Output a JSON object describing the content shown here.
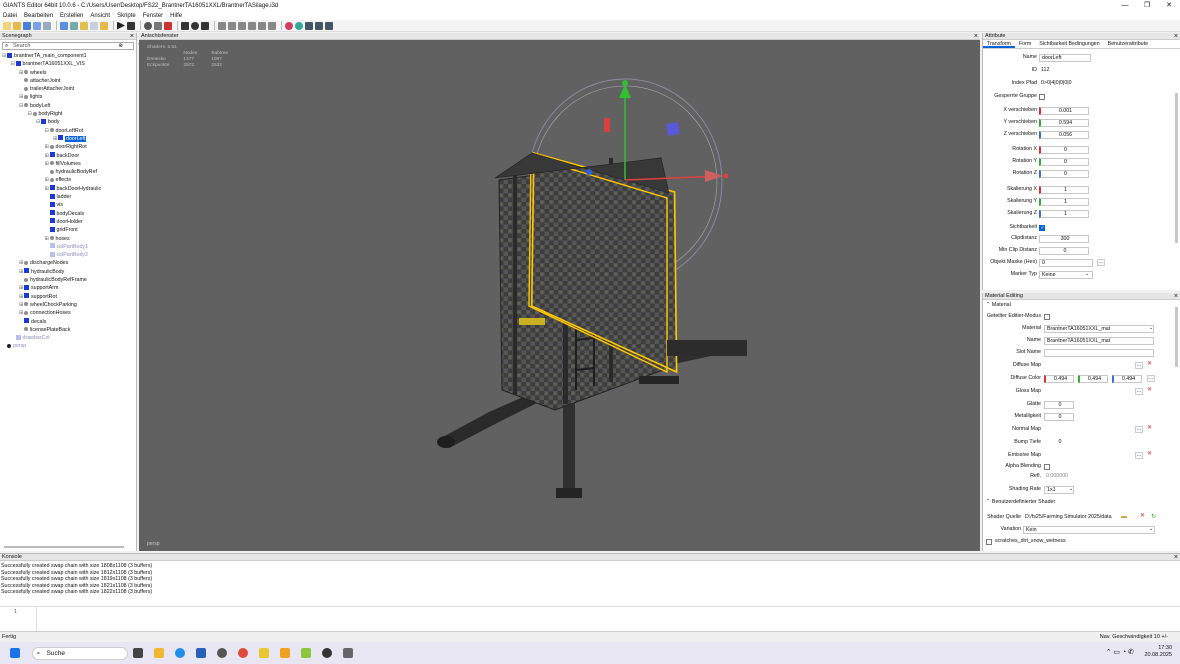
{
  "window": {
    "title": "GIANTS Editor 64bit 10.0.6 - C:/Users/User/Desktop/FS22_BrantnerTA16051XXL/BrantnerTASilage.i3d",
    "controls": [
      "—",
      "❐",
      "✕"
    ]
  },
  "menu": [
    "Datei",
    "Bearbeiten",
    "Erstellen",
    "Ansicht",
    "Skripte",
    "Fenster",
    "Hilfe"
  ],
  "scenegraph": {
    "title": "Scenegraph",
    "search_placeholder": "Search",
    "items": [
      {
        "label": "brantnerTA_main_component1",
        "depth": 0,
        "icon": "blue",
        "exp": "⊟"
      },
      {
        "label": "brantnerTA16051XXL_VIS",
        "depth": 1,
        "icon": "blue",
        "exp": "⊟"
      },
      {
        "label": "wheels",
        "depth": 2,
        "icon": "tg",
        "exp": "⊞"
      },
      {
        "label": "attacherJoint",
        "depth": 2,
        "icon": "tg",
        "exp": ""
      },
      {
        "label": "trailerAttacherJoint",
        "depth": 2,
        "icon": "tg",
        "exp": ""
      },
      {
        "label": "lights",
        "depth": 2,
        "icon": "tg",
        "exp": "⊞"
      },
      {
        "label": "bodyLeft",
        "depth": 2,
        "icon": "tg",
        "exp": "⊟"
      },
      {
        "label": "bodyRight",
        "depth": 3,
        "icon": "tg",
        "exp": "⊟"
      },
      {
        "label": "body",
        "depth": 4,
        "icon": "blue",
        "exp": "⊟"
      },
      {
        "label": "doorLeftRot",
        "depth": 5,
        "icon": "tg",
        "exp": "⊟"
      },
      {
        "label": "doorLeft",
        "depth": 6,
        "icon": "blue",
        "exp": "⊞",
        "selected": true
      },
      {
        "label": "doorRightRot",
        "depth": 5,
        "icon": "tg",
        "exp": "⊞"
      },
      {
        "label": "backDoor",
        "depth": 5,
        "icon": "blue",
        "exp": "⊞"
      },
      {
        "label": "fillVolumes",
        "depth": 5,
        "icon": "tg",
        "exp": "⊞"
      },
      {
        "label": "hydraulicBodyRef",
        "depth": 5,
        "icon": "tg",
        "exp": ""
      },
      {
        "label": "effects",
        "depth": 5,
        "icon": "tg",
        "exp": "⊞"
      },
      {
        "label": "backDoorHydraulic",
        "depth": 5,
        "icon": "blue",
        "exp": "⊞"
      },
      {
        "label": "ladder",
        "depth": 5,
        "icon": "blue",
        "exp": ""
      },
      {
        "label": "vis",
        "depth": 5,
        "icon": "blue",
        "exp": ""
      },
      {
        "label": "bodyDecals",
        "depth": 5,
        "icon": "blue",
        "exp": ""
      },
      {
        "label": "doorHolder",
        "depth": 5,
        "icon": "blue",
        "exp": ""
      },
      {
        "label": "gridFront",
        "depth": 5,
        "icon": "blue",
        "exp": ""
      },
      {
        "label": "hoses",
        "depth": 5,
        "icon": "tg",
        "exp": "⊞"
      },
      {
        "label": "colPartBody1",
        "depth": 5,
        "icon": "light",
        "exp": "",
        "dim": true
      },
      {
        "label": "colPartBody2",
        "depth": 5,
        "icon": "light",
        "exp": "",
        "dim": true
      },
      {
        "label": "dischargeNodes",
        "depth": 2,
        "icon": "tg",
        "exp": "⊞"
      },
      {
        "label": "hydraulicBody",
        "depth": 2,
        "icon": "blue",
        "exp": "⊞"
      },
      {
        "label": "hydraulicBodyRefFrame",
        "depth": 2,
        "icon": "tg",
        "exp": ""
      },
      {
        "label": "supportArm",
        "depth": 2,
        "icon": "blue",
        "exp": "⊞"
      },
      {
        "label": "supportRot",
        "depth": 2,
        "icon": "blue",
        "exp": "⊞"
      },
      {
        "label": "wheelChockParking",
        "depth": 2,
        "icon": "tg",
        "exp": "⊞"
      },
      {
        "label": "connectionHoses",
        "depth": 2,
        "icon": "tg",
        "exp": "⊞"
      },
      {
        "label": "decals",
        "depth": 2,
        "icon": "blue",
        "exp": ""
      },
      {
        "label": "licensePlateBack",
        "depth": 2,
        "icon": "tg",
        "exp": ""
      },
      {
        "label": "drawbarCol",
        "depth": 1,
        "icon": "light",
        "exp": "",
        "dim": true
      },
      {
        "label": "persp",
        "depth": 0,
        "icon": "cam",
        "exp": "",
        "dim": true
      }
    ]
  },
  "viewport": {
    "title": "Anischtsfenster",
    "stats": {
      "header": "Shaders: 6.51",
      "col1": "Nodes",
      "col2": "Subtree",
      "rows": [
        {
          "label": "Dreiecke",
          "a": "1477",
          "b": "1997"
        },
        {
          "label": "Eckpunkte",
          "a": "2572",
          "b": "2632"
        }
      ]
    },
    "camera": "persp"
  },
  "attribute": {
    "title": "Attribute",
    "tabs": [
      "Transform",
      "Form",
      "Sichtbarkeit Bedingungen",
      "Benutzerattribute"
    ],
    "fields": {
      "name_label": "Name",
      "name": "doorLeft",
      "id_label": "ID",
      "id": "112",
      "index_label": "Index Pfad",
      "index": "0>0|4|0|0|0|0",
      "locked_label": "Gesperrte Gruppe",
      "x_label": "X verschieben",
      "x": "0.001",
      "y_label": "Y verschieben",
      "y": "0.594",
      "z_label": "Z verschieben",
      "z": "0.056",
      "rx_label": "Rotation X",
      "rx": "0",
      "ry_label": "Rotation Y",
      "ry": "0",
      "rz_label": "Rotation Z",
      "rz": "0",
      "sx_label": "Skalierung X",
      "sx": "1",
      "sy_label": "Skalierung Y",
      "sy": "1",
      "sz_label": "Skalierung Z",
      "sz": "1",
      "vis_label": "Sichtbarkeit",
      "clip_label": "Clipdistanz",
      "clip": "300",
      "minclip_label": "Min Clip Distanz",
      "minclip": "0",
      "mask_label": "Objekt Maske (Hex)",
      "mask": "0",
      "marker_label": "Marker Typ",
      "marker": "Keine"
    }
  },
  "material": {
    "title": "Material Editing",
    "section1": "Material",
    "shared_label": "Geteilter Editier-Modus",
    "material_label": "Material",
    "material": "BrantnerTA16051XXL_mat",
    "name_label": "Name",
    "name": "BrantnerTA16051XXL_mat",
    "slot_label": "Slot Name",
    "slot": "",
    "diffuse_map_label": "Diffuse Map",
    "diffuse_color_label": "Diffuse Color",
    "dr": "0.494",
    "dg": "0.494",
    "db": "0.494",
    "gloss_label": "Gloss Map",
    "glatte_label": "Glätte",
    "glatte": "0",
    "metal_label": "Metalligkeit",
    "metal": "0",
    "normal_label": "Normal Map",
    "bump_label": "Bump Tiefe",
    "bump": "0",
    "emissive_label": "Emissive Map",
    "alpha_label": "Alpha Blending",
    "refl_label": "Refl.",
    "refl": "0.000000",
    "shading_label": "Shading Rate",
    "shading": "1x1",
    "section2": "Benutzerdefinierter Shader",
    "shader_label": "Shader Quelle",
    "shader": "D:/fs25/Farming Simulator 2025/data",
    "variation_label": "Variation",
    "variation": "Kein",
    "extra": "scratches_dirt_snow_wetness"
  },
  "console": {
    "title": "Konsole",
    "lines": [
      "Successfully created swap chain with size 1808x1108 (3 buffers)",
      "Successfully created swap chain with size 1812x1108 (3 buffers)",
      "Successfully created swap chain with size 1819x1108 (3 buffers)",
      "Successfully created swap chain with size 1821x1108 (3 buffers)",
      "Successfully created swap chain with size 1822x1108 (3 buffers)"
    ],
    "line_number": "1"
  },
  "status": {
    "left": "Fertig",
    "right": "Nav. Geschwindigkeit 10 +/-"
  },
  "taskbar": {
    "search": "Suche",
    "time": "17:30",
    "date": "20.08.2025"
  }
}
